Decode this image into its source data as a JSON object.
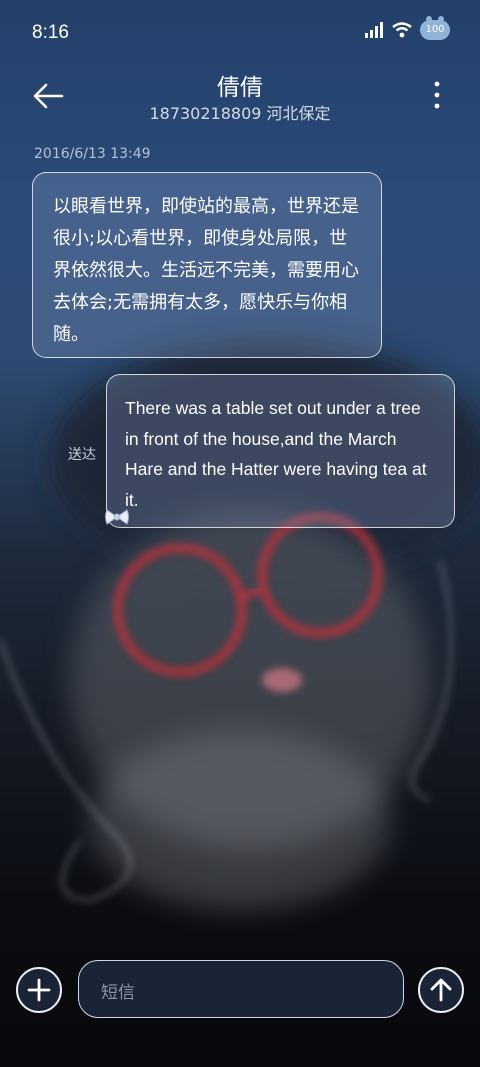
{
  "status_bar": {
    "time": "8:16",
    "signal_icon": "signal-icon",
    "wifi_icon": "wifi-icon",
    "battery_level": "100"
  },
  "header": {
    "back_icon": "arrow-left-icon",
    "contact_name": "倩倩",
    "contact_detail": "18730218809 河北保定",
    "more_icon": "more-vertical-icon"
  },
  "conversation": {
    "date": "2016/6/13 13:49",
    "messages": [
      {
        "direction": "incoming",
        "text": "以眼看世界，即使站的最高，世界还是很小;以心看世界，即使身处局限，世界依然很大。生活远不完美，需要用心去体会;无需拥有太多，愿快乐与你相随。"
      },
      {
        "direction": "outgoing",
        "text": "There was a table set out under a tree in front of the house,and the March Hare and the Hatter were having tea at it.",
        "status": "送达"
      }
    ]
  },
  "composer": {
    "add_icon": "plus-icon",
    "placeholder": "短信",
    "send_icon": "arrow-up-icon"
  },
  "colors": {
    "bubble_border": "#ffffff",
    "background_top": "#23406a",
    "background_bottom": "#07080b"
  }
}
